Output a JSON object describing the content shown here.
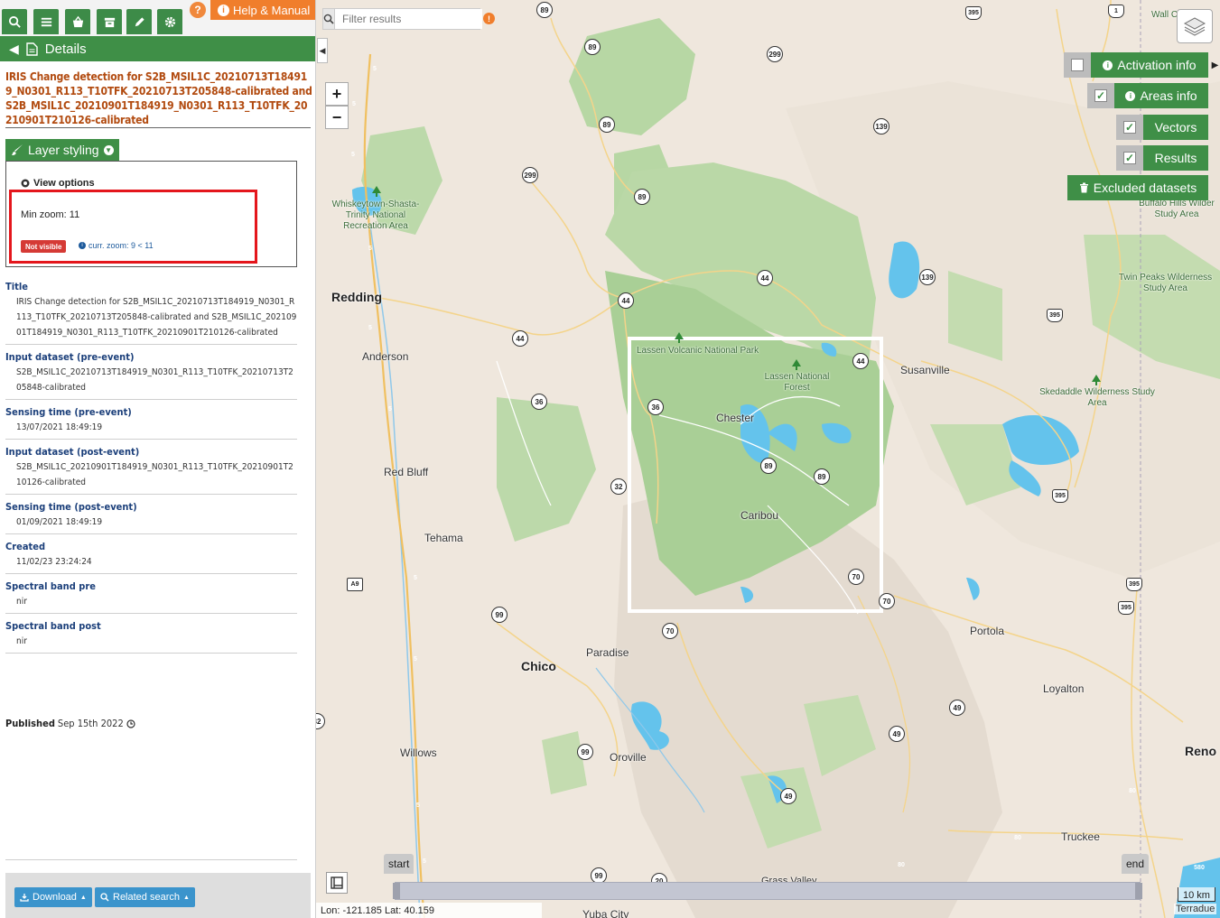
{
  "toolbar": {
    "help_label": "Help & Manual",
    "help_question": "?"
  },
  "details": {
    "back_label": "Details",
    "title": "IRIS Change detection for S2B_MSIL1C_20210713T184919_N0301_R113_T10TFK_20210713T205848-calibrated and S2B_MSIL1C_20210901T184919_N0301_R113_T10TFK_20210901T210126-calibrated"
  },
  "layer_styling": {
    "tab_label": "Layer styling",
    "view_options_label": "View options",
    "min_zoom_label": "Min zoom: 11",
    "status_badge": "Not visible",
    "current_zoom": "curr. zoom: 9 < 11"
  },
  "fields": [
    {
      "label": "Title",
      "value": "IRIS Change detection for S2B_MSIL1C_20210713T184919_N0301_R113_T10TFK_20210713T205848-calibrated and S2B_MSIL1C_20210901T184919_N0301_R113_T10TFK_20210901T210126-calibrated"
    },
    {
      "label": "Input dataset (pre-event)",
      "value": "S2B_MSIL1C_20210713T184919_N0301_R113_T10TFK_20210713T205848-calibrated"
    },
    {
      "label": "Sensing time (pre-event)",
      "value": "13/07/2021 18:49:19"
    },
    {
      "label": "Input dataset (post-event)",
      "value": "S2B_MSIL1C_20210901T184919_N0301_R113_T10TFK_20210901T210126-calibrated"
    },
    {
      "label": "Sensing time (post-event)",
      "value": "01/09/2021 18:49:19"
    },
    {
      "label": "Created",
      "value": "11/02/23 23:24:24"
    },
    {
      "label": "Spectral band pre",
      "value": "nir"
    },
    {
      "label": "Spectral band post",
      "value": "nir"
    }
  ],
  "published": {
    "label": "Published",
    "date": "Sep 15th 2022"
  },
  "footer": {
    "download_label": "Download",
    "related_label": "Related search"
  },
  "map": {
    "filter_placeholder": "Filter results",
    "zoom_in": "+",
    "zoom_out": "−",
    "layers": {
      "activation_info": "Activation info",
      "areas_info": "Areas info",
      "vectors": "Vectors",
      "results": "Results",
      "excluded": "Excluded datasets"
    },
    "timeline": {
      "start": "start",
      "end": "end"
    },
    "coords": "Lon: -121.185 Lat: 40.159",
    "scale": "10 km",
    "attribution": "Terradue",
    "places": {
      "redding": "Redding",
      "anderson": "Anderson",
      "red_bluff": "Red Bluff",
      "tehama": "Tehama",
      "chico": "Chico",
      "paradise": "Paradise",
      "oroville": "Oroville",
      "willows": "Willows",
      "yuba_city": "Yuba City",
      "susanville": "Susanville",
      "chester": "Chester",
      "caribou": "Caribou",
      "portola": "Portola",
      "loyalton": "Loyalton",
      "truckee": "Truckee",
      "reno": "Reno",
      "grass_valley": "Grass Valley",
      "lassen_volcanic": "Lassen Volcanic National Park",
      "lassen_forest": "Lassen National Forest",
      "whiskeytown": "Whiskeytown-Shasta-Trinity National Recreation Area",
      "skedaddle": "Skedaddle Wilderness Study Area",
      "twin_peaks": "Twin Peaks Wilderness Study Area",
      "buffalo_hills": "Buffalo Hills Wilder Study Area",
      "wall": "Wall C"
    }
  }
}
